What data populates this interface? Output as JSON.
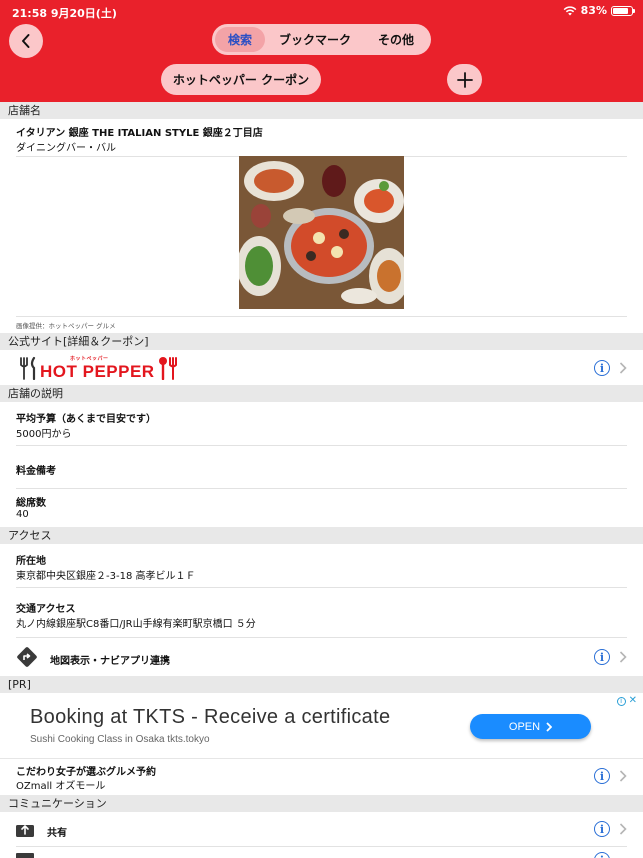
{
  "status_bar": {
    "time": "21:58  9月20日(土)",
    "battery": "83%",
    "battery_level": 0.83
  },
  "header": {
    "tabs": [
      {
        "label": "検索",
        "active": true
      },
      {
        "label": "ブックマーク",
        "active": false
      },
      {
        "label": "その他",
        "active": false
      }
    ],
    "coupon_button": "ホットペッパー クーポン",
    "icons": {
      "back": "chevron-left-icon",
      "add": "plus-icon"
    }
  },
  "shop": {
    "section_title": "店舗名",
    "name": "イタリアン 銀座 THE ITALIAN STYLE 銀座２丁目店",
    "genre": "ダイニングバー・バル",
    "photo_credit": "画像提供：ホットペッパー グルメ"
  },
  "official": {
    "section_title": "公式サイト[詳細＆クーポン]",
    "logo_text": "HOT PEPPER",
    "logo_sub": "ホットペッパー"
  },
  "description": {
    "section_title": "店舗の説明",
    "budget_label": "平均予算（あくまで目安です）",
    "budget_value": "5000円から",
    "fee_label": "料金備考",
    "seats_label": "総席数",
    "seats_value": "40"
  },
  "access": {
    "section_title": "アクセス",
    "address_label": "所在地",
    "address_value": "東京都中央区銀座２-3-18 高孝ビル１Ｆ",
    "transit_label": "交通アクセス",
    "transit_value": "丸ノ内線銀座駅C8番口/JR山手線有楽町駅京橋口 ５分",
    "map_link": "地図表示・ナビアプリ連携"
  },
  "pr": {
    "section_title": "[PR]",
    "ad_title": "Booking at TKTS - Receive a certificate",
    "ad_subtitle": "Sushi Cooking Class in Osaka tkts.tokyo",
    "ad_button": "OPEN",
    "item_title": "こだわり女子が選ぶグルメ予約",
    "item_sub": "OZmall オズモール"
  },
  "communication": {
    "section_title": "コミュニケーション",
    "share_label": "共有"
  },
  "colors": {
    "header": "#e9212b",
    "pill": "#fbc7c9",
    "link": "#2a6fd6",
    "ad_button": "#1a8cff"
  }
}
